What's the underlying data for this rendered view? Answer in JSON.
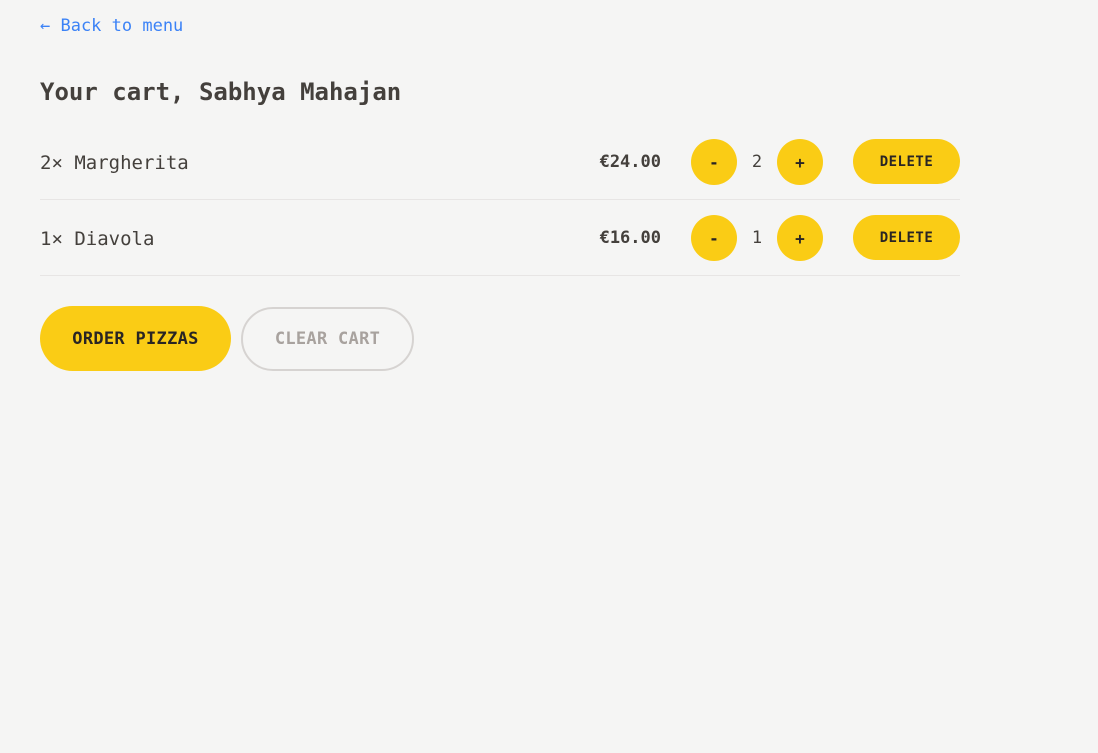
{
  "nav": {
    "back_label": "← Back to menu"
  },
  "cart": {
    "title": "Your cart, Sabhya Mahajan",
    "items": [
      {
        "name": "2× Margherita",
        "price": "€24.00",
        "decrement_label": "-",
        "quantity": "2",
        "increment_label": "+",
        "delete_label": "DELETE"
      },
      {
        "name": "1× Diavola",
        "price": "€16.00",
        "decrement_label": "-",
        "quantity": "1",
        "increment_label": "+",
        "delete_label": "DELETE"
      }
    ]
  },
  "actions": {
    "order_label": "ORDER PIZZAS",
    "clear_label": "CLEAR CART"
  },
  "colors": {
    "accent": "#facc15",
    "link": "#3b82f6",
    "text": "#44403c",
    "background": "#f5f5f4"
  }
}
